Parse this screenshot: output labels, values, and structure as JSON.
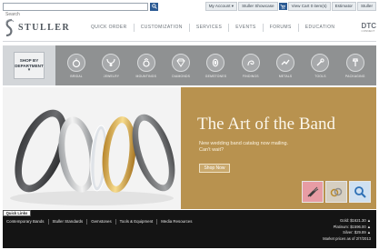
{
  "topbar": {
    "search_placeholder": "Search",
    "links": [
      "My Account ▾",
      "Stuller Showcase",
      "View Cart",
      "Estimator",
      "Stuller"
    ],
    "cart_count": "0 item(s)"
  },
  "logo": {
    "text": "STULLER"
  },
  "nav": {
    "items": [
      "QUICK ORDER",
      "CUSTOMIZATION",
      "SERVICES",
      "EVENTS",
      "FORUMS",
      "EDUCATION"
    ]
  },
  "dtc": {
    "text": "DTC",
    "sub": "CONNECT"
  },
  "shop_dept": {
    "label_1": "SHOP BY",
    "label_2": "DEPARTMENT"
  },
  "departments": [
    {
      "label": "BRIDAL",
      "icon": "ring-icon"
    },
    {
      "label": "JEWELRY",
      "icon": "necklace-icon"
    },
    {
      "label": "MOUNTINGS",
      "icon": "mounting-icon"
    },
    {
      "label": "DIAMONDS",
      "icon": "diamond-icon"
    },
    {
      "label": "GEMSTONES",
      "icon": "gemstone-icon"
    },
    {
      "label": "FINDINGS",
      "icon": "findings-icon"
    },
    {
      "label": "METALS",
      "icon": "metals-icon"
    },
    {
      "label": "TOOLS",
      "icon": "tools-icon"
    },
    {
      "label": "PACKAGING",
      "icon": "packaging-icon"
    }
  ],
  "hero": {
    "title": "The Art of the Band",
    "subtitle": "New wedding band catalog now mailing. Can't wait?",
    "button": "Shop Now"
  },
  "footer": {
    "quick_links_tab": "Quick Links",
    "links": [
      "Contemporary Bands",
      "Stuller Standards",
      "Gemstones",
      "Tools & Equipment",
      "Media Resources"
    ],
    "metals": [
      "Gold: $1621.30 ▲",
      "Platinum: $1596.00 ▲",
      "Silver: $29.89 ▲",
      "Market prices as of 2/7/2013"
    ]
  },
  "colors": {
    "hero_gold": "#b8924f",
    "nav_bar": "#8f9192",
    "footer": "#141414",
    "brand_blue": "#2c5b94"
  }
}
